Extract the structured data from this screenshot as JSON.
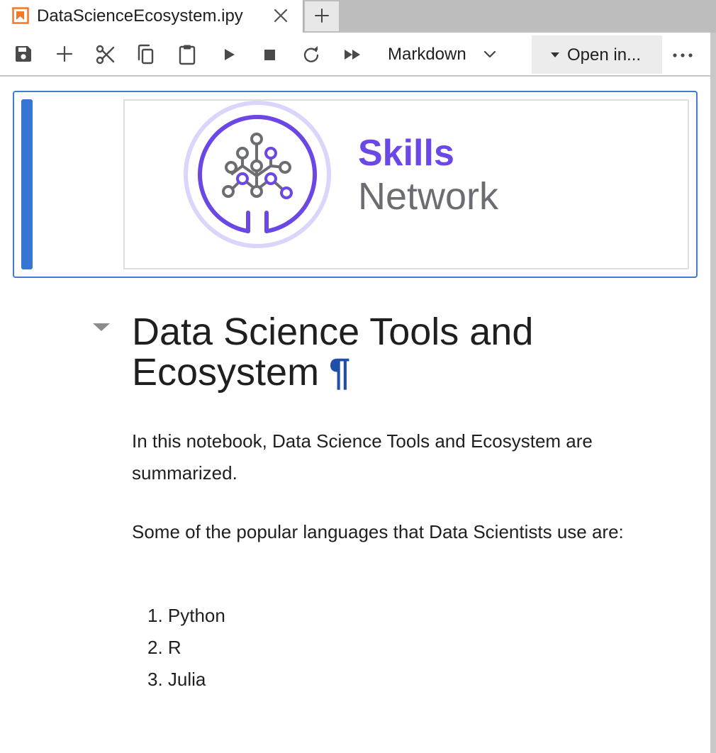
{
  "tab": {
    "title": "DataScienceEcosystem.ipy",
    "icon": "notebook-icon",
    "accent": "#f37726"
  },
  "toolbar": {
    "buttons": [
      "save-icon",
      "add-cell-icon",
      "cut-icon",
      "copy-icon",
      "paste-icon",
      "run-icon",
      "stop-icon",
      "restart-icon",
      "run-all-icon"
    ],
    "cell_type": "Markdown",
    "open_in_label": "Open in...",
    "more_icon": "ellipsis-icon"
  },
  "image_cell": {
    "logo_word_1": "Skills",
    "logo_word_2": "Network",
    "logo_colors": {
      "purple": "#6b48e6",
      "gray": "#6c6d72",
      "ring": "#dcd4fb"
    },
    "selection_color": "#3e7dd0"
  },
  "markdown": {
    "heading": "Data Science Tools and Ecosystem",
    "anchor": "¶",
    "intro": "In this notebook, Data Science Tools and Ecosystem are summarized.",
    "languages_intro": "Some of the popular languages that Data Scientists use are:",
    "languages": [
      "1. Python",
      "2. R",
      "3. Julia"
    ]
  }
}
